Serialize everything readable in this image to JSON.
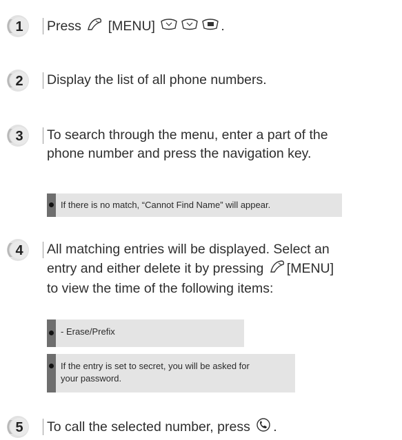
{
  "steps": [
    {
      "num": "1",
      "text_a": "Press",
      "text_b": "[MENU]",
      "text_c": "."
    },
    {
      "num": "2",
      "text": "Display the list of all phone numbers."
    },
    {
      "num": "3",
      "line1": "To search through the menu, enter a part of the",
      "line2": "phone number and press the navigation key."
    },
    {
      "num": "4",
      "line1": "All matching entries will be displayed. Select an",
      "line2_a": "entry and either delete it by pressing",
      "line2_b": "[MENU]",
      "line3": "to view the time of the following items:"
    },
    {
      "num": "5",
      "text_a": "To call the selected number, press",
      "text_b": "."
    }
  ],
  "notes": {
    "no_match": "If there is no match, “Cannot Find Name” will appear.",
    "erase_prefix": "- Erase/Prefix",
    "secret_line1": "If the entry is set to secret, you will be asked for",
    "secret_line2": "your password."
  },
  "icons": {
    "menu_key": "menu-soft-key-icon",
    "nav_key_1": "navigation-key-icon",
    "nav_key_2": "navigation-key-icon",
    "number_key": "number-key-icon",
    "send_key": "send-call-key-icon"
  }
}
